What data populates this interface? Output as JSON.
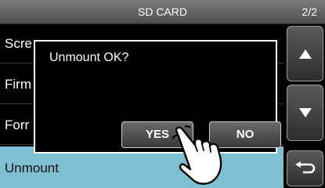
{
  "header": {
    "title": "SD CARD",
    "page_indicator": "2/2"
  },
  "menu": {
    "items": [
      {
        "label": "Scre"
      },
      {
        "label": "Firm"
      },
      {
        "label": "Forr"
      },
      {
        "label": "Unmount",
        "selected": true
      }
    ]
  },
  "side_buttons": {
    "up_icon": "triangle-up-icon",
    "down_icon": "triangle-down-icon",
    "back_icon": "return-arrow-icon"
  },
  "dialog": {
    "message": "Unmount OK?",
    "yes_label": "YES",
    "no_label": "NO"
  },
  "colors": {
    "selected_row": "#7fbfd2",
    "title_bar": "#6a6a6a",
    "dialog_border": "#ffffff"
  },
  "pointer": {
    "icon": "pointing-hand-icon"
  }
}
